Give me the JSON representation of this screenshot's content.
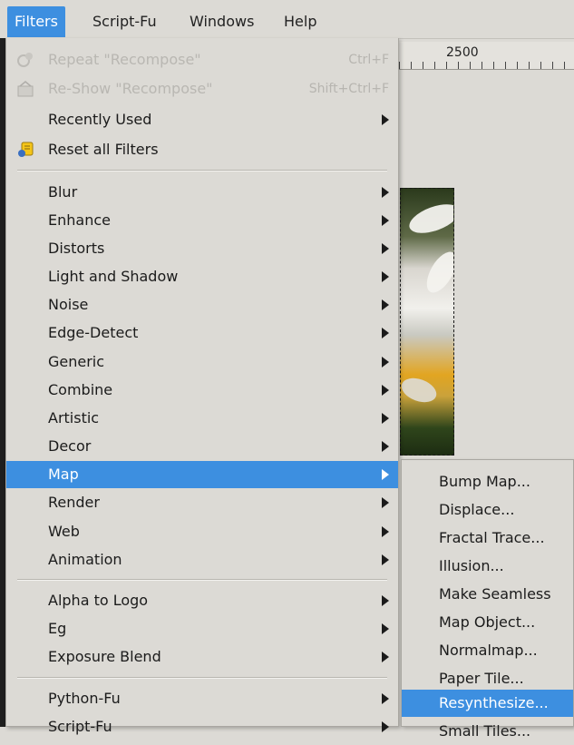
{
  "menubar": {
    "items": [
      {
        "label": "Filters"
      },
      {
        "label": "Script-Fu"
      },
      {
        "label": "Windows"
      },
      {
        "label": "Help"
      }
    ],
    "active_color": "#3d8fe0"
  },
  "ruler": {
    "label": "2500"
  },
  "filters_menu": {
    "repeat": {
      "label": "Repeat \"Recompose\"",
      "shortcut": "Ctrl+F",
      "icon": "repeat-icon"
    },
    "reshow": {
      "label": "Re-Show \"Recompose\"",
      "shortcut": "Shift+Ctrl+F",
      "icon": "reshow-icon"
    },
    "recently_used": {
      "label": "Recently Used"
    },
    "reset_all": {
      "label": "Reset all Filters",
      "icon": "reset-filters-icon"
    },
    "categories": [
      {
        "label": "Blur"
      },
      {
        "label": "Enhance"
      },
      {
        "label": "Distorts"
      },
      {
        "label": "Light and Shadow"
      },
      {
        "label": "Noise"
      },
      {
        "label": "Edge-Detect"
      },
      {
        "label": "Generic"
      },
      {
        "label": "Combine"
      },
      {
        "label": "Artistic"
      },
      {
        "label": "Decor"
      },
      {
        "label": "Map"
      },
      {
        "label": "Render"
      },
      {
        "label": "Web"
      },
      {
        "label": "Animation"
      }
    ],
    "scripts": [
      {
        "label": "Alpha to Logo"
      },
      {
        "label": "Eg"
      },
      {
        "label": "Exposure Blend"
      }
    ],
    "python": [
      {
        "label": "Python-Fu"
      },
      {
        "label": "Script-Fu"
      }
    ]
  },
  "map_submenu": {
    "items": [
      {
        "label": "Bump Map..."
      },
      {
        "label": "Displace..."
      },
      {
        "label": "Fractal Trace..."
      },
      {
        "label": "Illusion..."
      },
      {
        "label": "Make Seamless"
      },
      {
        "label": "Map Object..."
      },
      {
        "label": "Normalmap..."
      },
      {
        "label": "Paper Tile..."
      },
      {
        "label": "Resynthesize..."
      },
      {
        "label": "Small Tiles..."
      }
    ]
  }
}
